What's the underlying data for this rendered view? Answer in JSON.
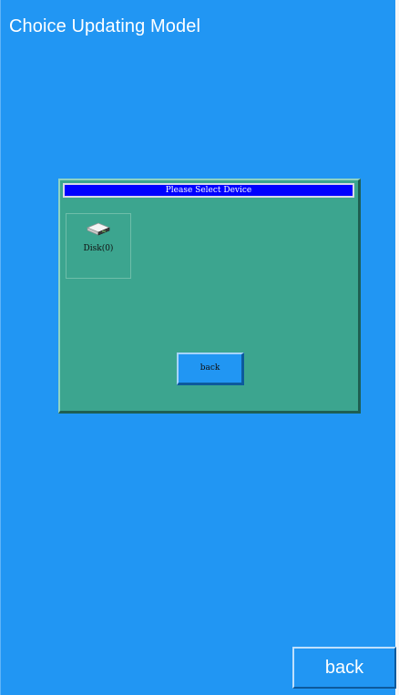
{
  "screen": {
    "title": "Choice Updating Model",
    "background_color": "#2196f3"
  },
  "dialog": {
    "title": "Please Select Device",
    "title_bar_color": "#0000ff",
    "panel_color": "#3ca58f",
    "devices": [
      {
        "label": "Disk(0)",
        "icon": "disk-drive-icon"
      }
    ],
    "back_label": "back"
  },
  "footer": {
    "back_label": "back"
  }
}
